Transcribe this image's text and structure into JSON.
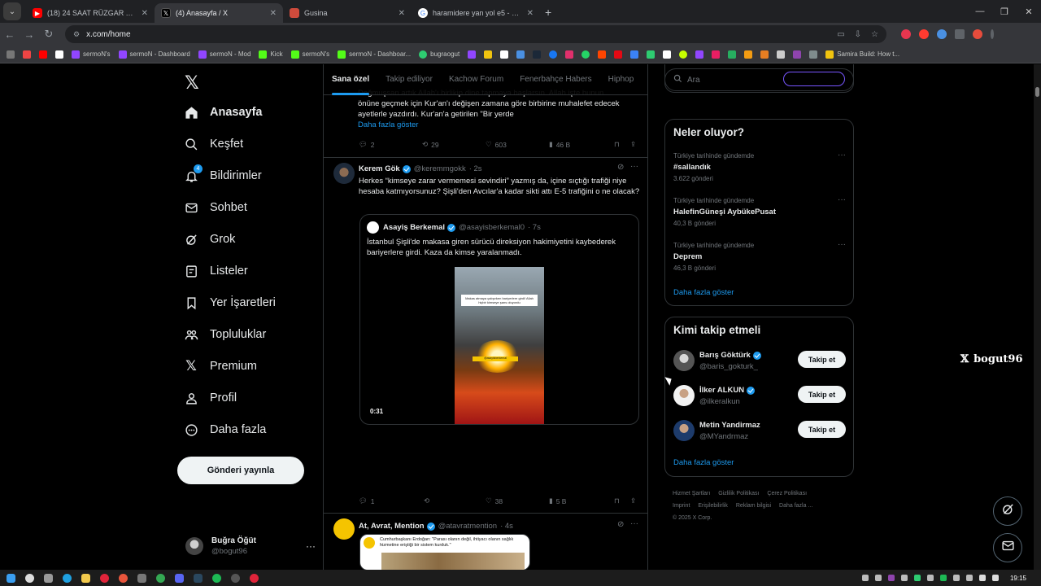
{
  "browser": {
    "tabs": [
      {
        "title": "(18) 24 SAAT RÜZGAR TÜRBİNİ",
        "fav_color": "#ff0000"
      },
      {
        "title": "(4) Anasayfa / X",
        "fav_color": "#ffffff"
      },
      {
        "title": "Gusina",
        "fav_color": "#cf4b3c"
      },
      {
        "title": "haramidere yan yol e5 - Google",
        "fav_color": "#4285f4"
      }
    ],
    "url": "x.com/home",
    "bookmarks": [
      "sermoN's",
      "sermoN - Dashboard",
      "sermoN - Mod",
      "Kick",
      "sermoN's",
      "sermoN - Dashboar...",
      "bugraogut",
      "Samira Build: How t..."
    ]
  },
  "nav": {
    "items": [
      {
        "label": "Anasayfa",
        "icon": "home-icon"
      },
      {
        "label": "Keşfet",
        "icon": "search-icon"
      },
      {
        "label": "Bildirimler",
        "icon": "bell-icon",
        "badge": "4"
      },
      {
        "label": "Sohbet",
        "icon": "mail-icon"
      },
      {
        "label": "Grok",
        "icon": "grok-icon"
      },
      {
        "label": "Listeler",
        "icon": "list-icon"
      },
      {
        "label": "Yer İşaretleri",
        "icon": "bookmark-icon"
      },
      {
        "label": "Topluluklar",
        "icon": "communities-icon"
      },
      {
        "label": "Premium",
        "icon": "x-premium-icon"
      },
      {
        "label": "Profil",
        "icon": "user-icon"
      },
      {
        "label": "Daha fazla",
        "icon": "more-circle-icon"
      }
    ],
    "post_button": "Gönderi yayınla",
    "profile": {
      "name": "Buğra Öğüt",
      "handle": "@bogut96"
    }
  },
  "timeline": {
    "tabs": [
      "Sana özel",
      "Takip ediliyor",
      "Kachow Forum",
      "Fenerbahçe Habers",
      "Hiphop"
    ],
    "top_tweet": {
      "text_line1": "Doğmuşsan artık Allah'ı birlikip dine tapmaya başlarsın. Allah işte bunun",
      "text_line2": "önüne geçmek için Kur'an'ı değişen zamana göre birbirine muhalefet edecek",
      "text_line3": "ayetlerle yazdırdı. Kur'an'a getirilen \"Bir yerde",
      "show_more": "Daha fazla göster",
      "replies": "2",
      "retweets": "29",
      "likes": "603",
      "views": "46 B"
    },
    "tweet2": {
      "name": "Kerem Gök",
      "handle": "@keremmgokk",
      "time": "· 2s",
      "text": "Herkes “kimseye zarar vermemesi sevindiri” yazmış da, içine sıçtığı trafiği niye hesaba katmıyorsunuz? Şişli'den Avcılar'a kadar sikti attı E-5 trafiğini o ne olacak?",
      "quote": {
        "name": "Asayiş Berkemal",
        "handle": "@asayisberkemal0",
        "time": "· 7s",
        "text": "İstanbul Şişli'de makasa giren sürücü direksiyon hakimiyetini kaybederek bariyerlere girdi. Kaza da kimse yaralanmadı.",
        "video_caption": "Makas atmaya çalışırken bariyerlere girdi! Allah hiçbir kimseye şans oluyordu",
        "video_tag": "@asayisberkemal",
        "duration": "0:31"
      },
      "replies": "1",
      "retweets": "",
      "likes": "38",
      "views": "5 B"
    },
    "tweet3": {
      "name": "At, Avrat, Mention",
      "handle": "@atavratmention",
      "time": "· 4s",
      "card_text": "Cumhurbaşkanı Erdoğan: \"Parası olanın değil, ihtiyacı olanın sağlık hizmetine eriştiği bir sistem kurduk.\""
    }
  },
  "sidebar": {
    "search_placeholder": "Ara",
    "trends_title": "Neler oluyor?",
    "trends": [
      {
        "context": "Türkiye tarihinde gündemde",
        "name": "#sallandık",
        "count": "3.622 gönderi"
      },
      {
        "context": "Türkiye tarihinde gündemde",
        "name": "HalefinGüneşi AybükePusat",
        "count": "40,3 B gönderi"
      },
      {
        "context": "Türkiye tarihinde gündemde",
        "name": "Deprem",
        "count": "46,3 B gönderi"
      }
    ],
    "trends_more": "Daha fazla göster",
    "who_title": "Kimi takip etmeli",
    "who": [
      {
        "name": "Barış Göktürk",
        "handle": "@baris_gokturk_",
        "button": "Takip et"
      },
      {
        "name": "İlker ALKUN",
        "handle": "@ilkeralkun",
        "button": "Takip et"
      },
      {
        "name": "Metin Yandirmaz",
        "handle": "@MYandrmaz",
        "button": "Takip et"
      }
    ],
    "who_more": "Daha fazla göster",
    "footer": [
      "Hizmet Şartları",
      "Gizlilik Politikası",
      "Çerez Politikası",
      "Imprint",
      "Erişilebilirlik",
      "Reklam bilgisi",
      "Daha fazla ...",
      "© 2025 X Corp."
    ]
  },
  "watermark": "bogut96",
  "taskbar": {
    "time": "19:15"
  }
}
